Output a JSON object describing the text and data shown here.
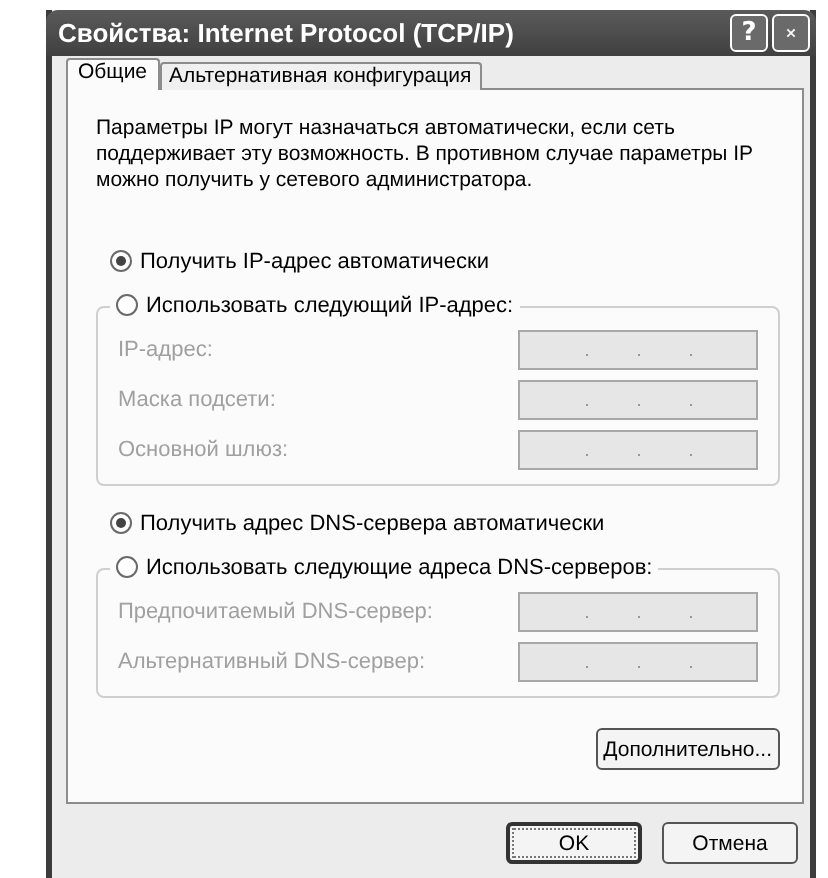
{
  "window": {
    "title": "Свойства: Internet Protocol (TCP/IP)",
    "help_button": "?"
  },
  "tabs": [
    {
      "label": "Общие",
      "selected": true
    },
    {
      "label": "Альтернативная конфигурация",
      "selected": false
    }
  ],
  "description": "Параметры IP могут назначаться автоматически, если сеть поддерживает эту возможность. В противном случае параметры IP можно получить у сетевого администратора.",
  "ip_settings": {
    "auto_option": {
      "label": "Получить IP-адрес автоматически",
      "selected": true
    },
    "manual_option": {
      "label": "Использовать следующий IP-адрес:",
      "selected": false
    },
    "fields": [
      {
        "label": "IP-адрес:",
        "disabled": true
      },
      {
        "label": "Маска подсети:",
        "disabled": true
      },
      {
        "label": "Основной шлюз:",
        "disabled": true
      }
    ]
  },
  "dns_settings": {
    "auto_option": {
      "label": "Получить адрес DNS-сервера автоматически",
      "selected": true
    },
    "manual_option": {
      "label": "Использовать следующие адреса DNS-серверов:",
      "selected": false
    },
    "fields": [
      {
        "label": "Предпочитаемый DNS-сервер:",
        "disabled": true
      },
      {
        "label": "Альтернативный DNS-сервер:",
        "disabled": true
      }
    ]
  },
  "advanced_button": "Дополнительно...",
  "buttons": [
    {
      "label": "OK",
      "default": true
    },
    {
      "label": "Отмена",
      "default": false
    }
  ]
}
